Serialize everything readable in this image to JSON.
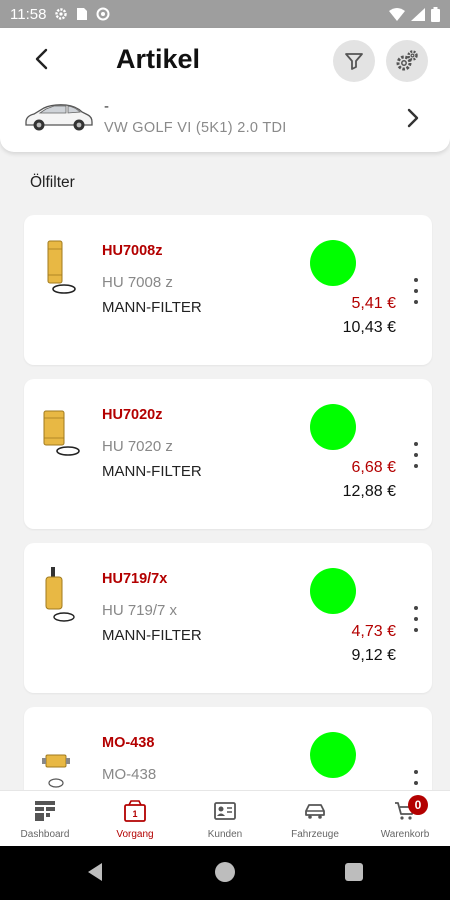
{
  "status_bar": {
    "time": "11:58"
  },
  "header": {
    "title": "Artikel",
    "vehicle": {
      "dash": "-",
      "name": "VW GOLF VI (5K1) 2.0 TDI"
    }
  },
  "section": {
    "title": "Ölfilter"
  },
  "products": [
    {
      "code": "HU7008z",
      "desc": "HU 7008 z",
      "brand": "MANN-FILTER",
      "price_red": "5,41 €",
      "price_black": "10,43 €",
      "availability_color": "#00ff00"
    },
    {
      "code": "HU7020z",
      "desc": "HU 7020 z",
      "brand": "MANN-FILTER",
      "price_red": "6,68 €",
      "price_black": "12,88 €",
      "availability_color": "#00ff00"
    },
    {
      "code": "HU719/7x",
      "desc": "HU 719/7 x",
      "brand": "MANN-FILTER",
      "price_red": "4,73 €",
      "price_black": "9,12 €",
      "availability_color": "#00ff00"
    },
    {
      "code": "MO-438",
      "desc": "MO-438",
      "brand": "",
      "price_red": "",
      "price_black": "",
      "availability_color": "#00ff00"
    }
  ],
  "nav": {
    "items": [
      {
        "label": "Dashboard",
        "icon": "dashboard-icon"
      },
      {
        "label": "Vorgang",
        "icon": "vorgang-icon",
        "active": true
      },
      {
        "label": "Kunden",
        "icon": "kunden-icon"
      },
      {
        "label": "Fahrzeuge",
        "icon": "fahrzeuge-icon"
      },
      {
        "label": "Warenkorb",
        "icon": "cart-icon",
        "badge": "0"
      }
    ]
  },
  "colors": {
    "accent": "#b30000",
    "available": "#00ff00"
  }
}
